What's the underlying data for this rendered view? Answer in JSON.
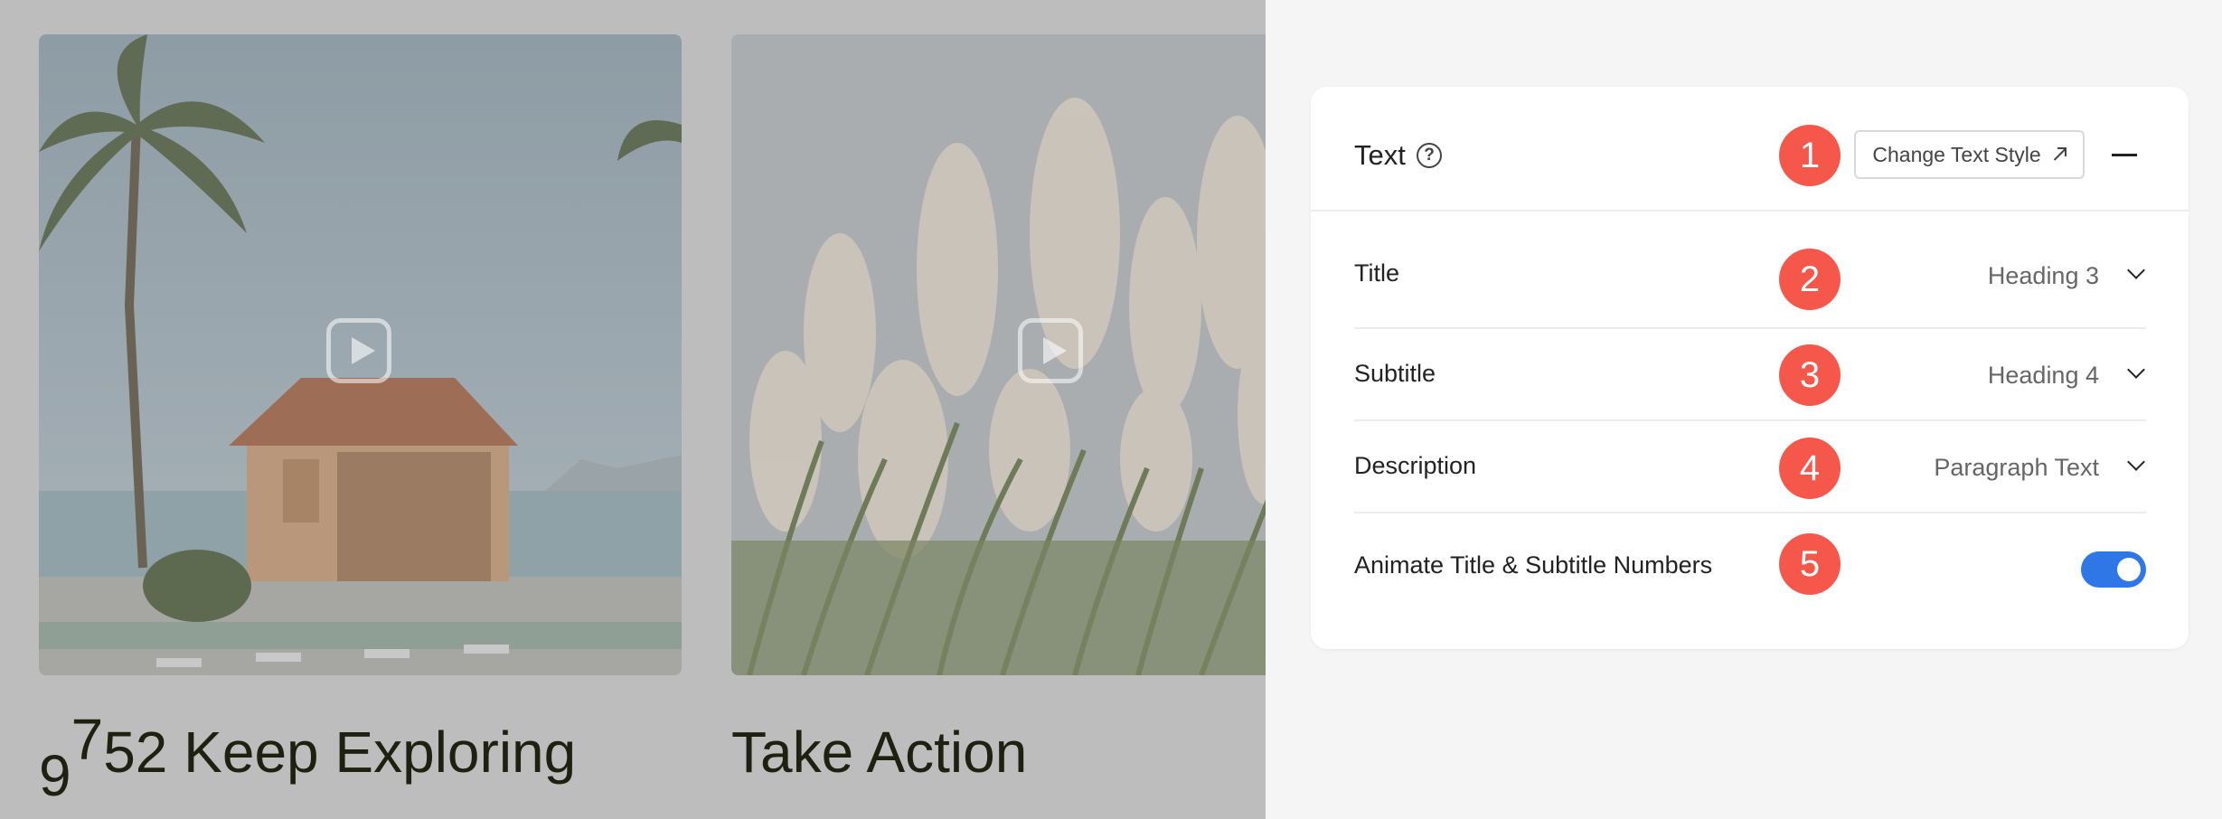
{
  "preview": {
    "cards": [
      {
        "caption_number": [
          "9",
          "7",
          "5",
          "2"
        ],
        "caption_text": "Keep Exploring"
      },
      {
        "caption_text": "Take Action"
      }
    ]
  },
  "panel": {
    "title": "Text",
    "help_icon": "?",
    "change_style_label": "Change Text Style",
    "rows": [
      {
        "badge": "2",
        "label": "Title",
        "value": "Heading 3"
      },
      {
        "badge": "3",
        "label": "Subtitle",
        "value": "Heading 4"
      },
      {
        "badge": "4",
        "label": "Description",
        "value": "Paragraph Text"
      },
      {
        "badge": "5",
        "label": "Animate Title & Subtitle Numbers",
        "toggle_on": true
      }
    ],
    "header_badge": "1"
  },
  "colors": {
    "badge": "#f5574b",
    "toggle": "#2f76e6"
  },
  "icons": [
    "help-circle-icon",
    "external-arrow-icon",
    "collapse-minus-icon",
    "chevron-down-icon",
    "play-icon"
  ]
}
